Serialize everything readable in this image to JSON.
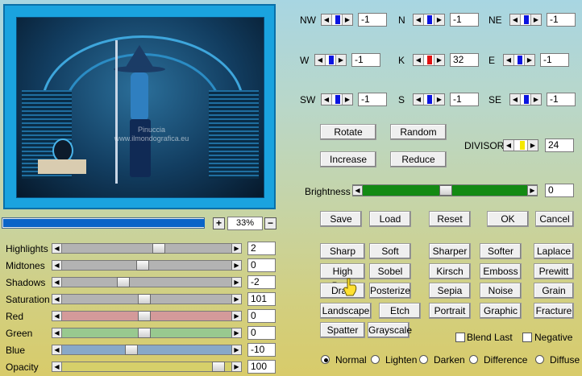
{
  "preview": {
    "watermark_line1": "Pinuccia",
    "watermark_line2": "www.ilmondografica.eu"
  },
  "zoom": {
    "plus": "+",
    "minus": "−",
    "value": "33%",
    "progress": 1.0
  },
  "adjust": [
    {
      "label": "Highlights",
      "value": "2",
      "color": "#b3b3b3"
    },
    {
      "label": "Midtones",
      "value": "0",
      "color": "#b3b3b3"
    },
    {
      "label": "Shadows",
      "value": "-2",
      "color": "#b3b3b3"
    },
    {
      "label": "Saturation",
      "value": "101",
      "color": "#b3b3b3"
    },
    {
      "label": "Red",
      "value": "0",
      "color": "#d49a9a"
    },
    {
      "label": "Green",
      "value": "0",
      "color": "#98c98f"
    },
    {
      "label": "Blue",
      "value": "-10",
      "color": "#88a8c8"
    },
    {
      "label": "Opacity",
      "value": "100",
      "color": "#d6d06a"
    }
  ],
  "compass": [
    {
      "label": "NW",
      "value": "-1"
    },
    {
      "label": "N",
      "value": "-1"
    },
    {
      "label": "NE",
      "value": "-1"
    },
    {
      "label": "W",
      "value": "-1"
    },
    {
      "label": "K",
      "value": "32"
    },
    {
      "label": "E",
      "value": "-1"
    },
    {
      "label": "SW",
      "value": "-1"
    },
    {
      "label": "S",
      "value": "-1"
    },
    {
      "label": "SE",
      "value": "-1"
    }
  ],
  "matrix_buttons": {
    "rotate": "Rotate",
    "random": "Random",
    "increase": "Increase",
    "reduce": "Reduce"
  },
  "divisor": {
    "label": "DIVISOR",
    "value": "24"
  },
  "brightness": {
    "label": "Brightness",
    "value": "0"
  },
  "actions": {
    "save": "Save",
    "load": "Load",
    "reset": "Reset",
    "ok": "OK",
    "cancel": "Cancel"
  },
  "presets": [
    [
      "Sharp",
      "Soft",
      "Sharper",
      "Softer",
      "Laplace"
    ],
    [
      "High Pass",
      "Sobel",
      "Kirsch",
      "Emboss",
      "Prewitt"
    ],
    [
      "Draw",
      "Posterize",
      "Sepia",
      "Noise",
      "Grain"
    ],
    [
      "Landscape",
      "Etch",
      "Portrait",
      "Graphic",
      "Fracture"
    ],
    [
      "Spatter",
      "Grayscale"
    ]
  ],
  "options": {
    "blend_last": "Blend Last",
    "negative": "Negative"
  },
  "blend_modes": {
    "selected": "Normal",
    "items": [
      "Normal",
      "Lighten",
      "Darken",
      "Difference",
      "Diffuse"
    ]
  }
}
